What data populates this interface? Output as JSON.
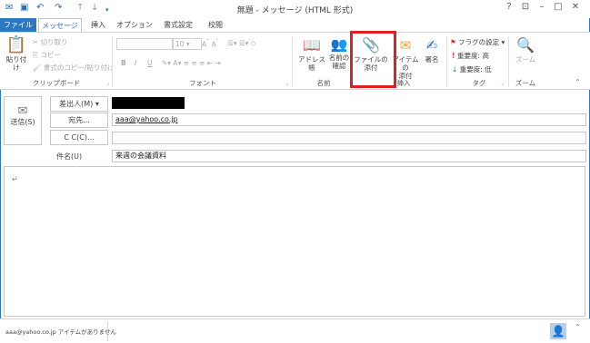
{
  "window": {
    "title": "無題 - メッセージ (HTML 形式)",
    "qa_icons": [
      "envelope-icon",
      "save-icon",
      "undo-icon",
      "redo-icon",
      "up-arrow-icon",
      "down-arrow-icon",
      "dropdown-icon"
    ],
    "controls": [
      "help-icon",
      "ribbon-display-icon",
      "minimize-icon",
      "maximize-icon",
      "close-icon"
    ]
  },
  "tabs": [
    "ファイル",
    "メッセージ",
    "挿入",
    "オプション",
    "書式設定",
    "校閲"
  ],
  "ribbon": {
    "clipboard": {
      "paste": "貼り付け",
      "cut": "切り取り",
      "copy": "コピー",
      "format_painter": "書式のコピー/貼り付け",
      "label": "クリップボード"
    },
    "font": {
      "size": "10",
      "bold": "B",
      "italic": "I",
      "underline": "U",
      "label": "フォント"
    },
    "names": {
      "address_book": "アドレス帳",
      "check_names_1": "名前の",
      "check_names_2": "確認",
      "label": "名前"
    },
    "include": {
      "attach_file_1": "ファイルの",
      "attach_file_2": "添付",
      "attach_item_1": "アイテムの",
      "attach_item_2": "添付",
      "signature": "署名",
      "label": "挿入"
    },
    "tags": {
      "follow_up": "フラグの設定",
      "high": "重要度: 高",
      "low": "重要度: 低",
      "label": "タグ"
    },
    "zoom": {
      "zoom": "ズーム",
      "label": "ズーム"
    },
    "highlight_color": "#e02020"
  },
  "compose": {
    "send": "送信(S)",
    "from": "差出人(M)",
    "to_button": "宛先...",
    "to_value": "aaa@yahoo.co.jp",
    "cc_button": "C C(C)...",
    "cc_value": "",
    "subject_label": "件名(U)",
    "subject_value": "来週の会議資料",
    "body_mark": "↵"
  },
  "status": {
    "text": "aaa@yahoo.co.jp アイテムがありません"
  }
}
